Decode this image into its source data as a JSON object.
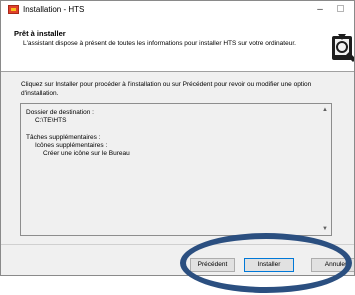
{
  "window": {
    "title": "Installation - HTS",
    "minimize_glyph": "–",
    "close_glyph": "×"
  },
  "header": {
    "title": "Prêt à installer",
    "description": "L'assistant dispose à présent de toutes les informations pour installer HTS sur votre ordinateur.",
    "icon": "installer-wizard-icon"
  },
  "instructions": "Cliquez sur Installer pour procéder à l'installation ou sur Précédent pour revoir ou modifier une option d'installation.",
  "memo": {
    "lines": [
      "Dossier de destination :",
      "C:\\TE\\HTS",
      "Tâches supplémentaires :",
      "Icônes supplémentaires :",
      "Créer une icône sur le Bureau"
    ],
    "scroll_up_glyph": "▲",
    "scroll_down_glyph": "▼"
  },
  "buttons": {
    "back_label": "Précédent",
    "install_label": "Installer",
    "cancel_label": "Annuler"
  },
  "colors": {
    "annotation_ellipse": "#2b4f80",
    "focus_border": "#0078d7",
    "app_icon": "#e0412a"
  }
}
